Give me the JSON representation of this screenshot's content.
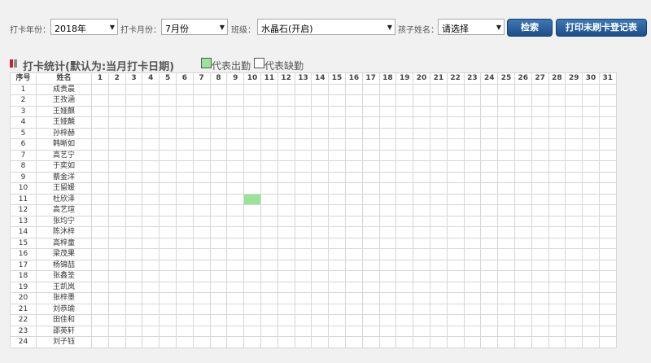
{
  "filters": {
    "year_label": "打卡年份：",
    "year_value": "2018年",
    "month_label": "打卡月份：",
    "month_value": "7月份",
    "class_label": "班级：",
    "class_value": "水晶石(开启)",
    "child_label": "孩子姓名：",
    "child_value": "请选择",
    "search_button": "检索",
    "print_button": "打印未刷卡登记表"
  },
  "section": {
    "title": "打卡统计(默认为:当月打卡日期)",
    "legend_present": "代表出勤",
    "legend_absent": "代表缺勤"
  },
  "colors": {
    "present": "#9be39b",
    "button": "#1d4f88",
    "title_mark_red": "#c0282e",
    "title_mark_gray": "#8a8a8a"
  },
  "table": {
    "header_index": "序号",
    "header_name": "姓名",
    "days": [
      "1",
      "2",
      "3",
      "4",
      "5",
      "6",
      "7",
      "8",
      "9",
      "10",
      "11",
      "12",
      "13",
      "14",
      "15",
      "16",
      "17",
      "18",
      "19",
      "20",
      "21",
      "22",
      "23",
      "24",
      "25",
      "26",
      "27",
      "28",
      "29",
      "30",
      "31"
    ],
    "rows": [
      {
        "index": "1",
        "name": "成贵晨",
        "present_days": []
      },
      {
        "index": "2",
        "name": "王孜涵",
        "present_days": []
      },
      {
        "index": "3",
        "name": "王娅麒",
        "present_days": []
      },
      {
        "index": "4",
        "name": "王娅麟",
        "present_days": []
      },
      {
        "index": "5",
        "name": "孙梓赫",
        "present_days": []
      },
      {
        "index": "6",
        "name": "韩晰如",
        "present_days": []
      },
      {
        "index": "7",
        "name": "高艺宁",
        "present_days": []
      },
      {
        "index": "8",
        "name": "于奕如",
        "present_days": []
      },
      {
        "index": "9",
        "name": "蔡金洋",
        "present_days": []
      },
      {
        "index": "10",
        "name": "王留媛",
        "present_days": []
      },
      {
        "index": "11",
        "name": "杜欣泽",
        "present_days": [
          10
        ]
      },
      {
        "index": "12",
        "name": "高艺瑄",
        "present_days": []
      },
      {
        "index": "13",
        "name": "张均宁",
        "present_days": []
      },
      {
        "index": "14",
        "name": "陈沐梓",
        "present_days": []
      },
      {
        "index": "15",
        "name": "高梓童",
        "present_days": []
      },
      {
        "index": "16",
        "name": "梁茂果",
        "present_days": []
      },
      {
        "index": "17",
        "name": "杨锦喆",
        "present_days": []
      },
      {
        "index": "18",
        "name": "张鑫筌",
        "present_days": []
      },
      {
        "index": "19",
        "name": "王凯岚",
        "present_days": []
      },
      {
        "index": "20",
        "name": "张梓墨",
        "present_days": []
      },
      {
        "index": "21",
        "name": "刘恭瑜",
        "present_days": []
      },
      {
        "index": "22",
        "name": "田佳和",
        "present_days": []
      },
      {
        "index": "23",
        "name": "邵英轩",
        "present_days": []
      },
      {
        "index": "24",
        "name": "刘子钰",
        "present_days": []
      }
    ]
  }
}
